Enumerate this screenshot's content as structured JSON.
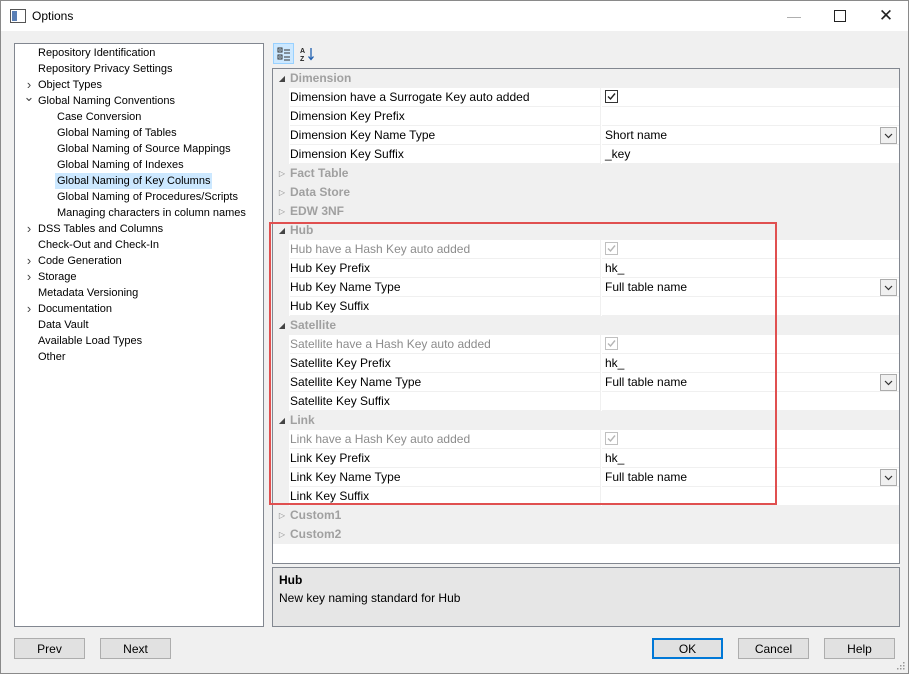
{
  "window": {
    "title": "Options"
  },
  "tree": [
    {
      "label": "Repository Identification",
      "level": 0,
      "arrow": ""
    },
    {
      "label": "Repository Privacy Settings",
      "level": 0,
      "arrow": ""
    },
    {
      "label": "Object Types",
      "level": 0,
      "arrow": "›"
    },
    {
      "label": "Global Naming Conventions",
      "level": 0,
      "arrow": "⌄"
    },
    {
      "label": "Case Conversion",
      "level": 1,
      "arrow": ""
    },
    {
      "label": "Global Naming of Tables",
      "level": 1,
      "arrow": ""
    },
    {
      "label": "Global Naming of Source Mappings",
      "level": 1,
      "arrow": ""
    },
    {
      "label": "Global Naming of Indexes",
      "level": 1,
      "arrow": ""
    },
    {
      "label": "Global Naming of Key Columns",
      "level": 1,
      "arrow": "",
      "selected": true
    },
    {
      "label": "Global Naming of Procedures/Scripts",
      "level": 1,
      "arrow": ""
    },
    {
      "label": "Managing characters in column names",
      "level": 1,
      "arrow": ""
    },
    {
      "label": "DSS Tables and Columns",
      "level": 0,
      "arrow": "›"
    },
    {
      "label": "Check-Out and Check-In",
      "level": 0,
      "arrow": ""
    },
    {
      "label": "Code Generation",
      "level": 0,
      "arrow": "›"
    },
    {
      "label": "Storage",
      "level": 0,
      "arrow": "›"
    },
    {
      "label": "Metadata Versioning",
      "level": 0,
      "arrow": ""
    },
    {
      "label": "Documentation",
      "level": 0,
      "arrow": "›"
    },
    {
      "label": "Data Vault",
      "level": 0,
      "arrow": ""
    },
    {
      "label": "Available Load Types",
      "level": 0,
      "arrow": ""
    },
    {
      "label": "Other",
      "level": 0,
      "arrow": ""
    }
  ],
  "toolbar": {
    "categorized_icon": "categorized-icon",
    "alphabetical_icon": "sort-az-icon"
  },
  "grid": [
    {
      "type": "cat",
      "label": "Dimension",
      "expanded": true
    },
    {
      "type": "prop",
      "name": "Dimension have a Surrogate Key auto added",
      "kind": "check",
      "checked": true,
      "disabled": false
    },
    {
      "type": "prop",
      "name": "Dimension Key Prefix",
      "kind": "text",
      "value": ""
    },
    {
      "type": "prop",
      "name": "Dimension Key Name Type",
      "kind": "dropdown",
      "value": "Short name"
    },
    {
      "type": "prop",
      "name": "Dimension Key Suffix",
      "kind": "text",
      "value": "_key"
    },
    {
      "type": "cat",
      "label": "Fact Table",
      "expanded": false
    },
    {
      "type": "cat",
      "label": "Data Store",
      "expanded": false
    },
    {
      "type": "cat",
      "label": "EDW 3NF",
      "expanded": false
    },
    {
      "type": "cat",
      "label": "Hub",
      "expanded": true
    },
    {
      "type": "prop",
      "name": "Hub have a Hash Key auto added",
      "kind": "check",
      "checked": true,
      "disabled": true
    },
    {
      "type": "prop",
      "name": "Hub Key Prefix",
      "kind": "text",
      "value": "hk_"
    },
    {
      "type": "prop",
      "name": "Hub Key Name Type",
      "kind": "dropdown",
      "value": "Full table name"
    },
    {
      "type": "prop",
      "name": "Hub Key Suffix",
      "kind": "text",
      "value": ""
    },
    {
      "type": "cat",
      "label": "Satellite",
      "expanded": true
    },
    {
      "type": "prop",
      "name": "Satellite have a Hash Key auto added",
      "kind": "check",
      "checked": true,
      "disabled": true
    },
    {
      "type": "prop",
      "name": "Satellite Key Prefix",
      "kind": "text",
      "value": "hk_"
    },
    {
      "type": "prop",
      "name": "Satellite Key Name Type",
      "kind": "dropdown",
      "value": "Full table name"
    },
    {
      "type": "prop",
      "name": "Satellite Key Suffix",
      "kind": "text",
      "value": ""
    },
    {
      "type": "cat",
      "label": "Link",
      "expanded": true
    },
    {
      "type": "prop",
      "name": "Link have a Hash Key auto added",
      "kind": "check",
      "checked": true,
      "disabled": true
    },
    {
      "type": "prop",
      "name": "Link Key Prefix",
      "kind": "text",
      "value": "hk_"
    },
    {
      "type": "prop",
      "name": "Link Key Name Type",
      "kind": "dropdown",
      "value": "Full table name"
    },
    {
      "type": "prop",
      "name": "Link Key Suffix",
      "kind": "text",
      "value": ""
    },
    {
      "type": "cat",
      "label": "Custom1",
      "expanded": false
    },
    {
      "type": "cat",
      "label": "Custom2",
      "expanded": false
    }
  ],
  "description": {
    "title": "Hub",
    "text": "New key naming standard for Hub"
  },
  "buttons": {
    "prev": "Prev",
    "next": "Next",
    "ok": "OK",
    "cancel": "Cancel",
    "help": "Help"
  },
  "colors": {
    "highlight": "#e05050",
    "selection": "#cce8ff",
    "accent": "#0078d7"
  }
}
